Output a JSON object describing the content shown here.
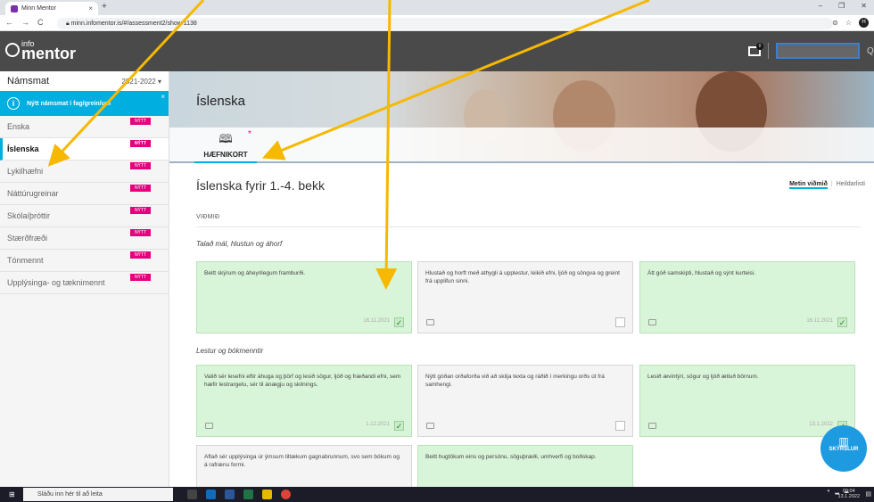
{
  "browser": {
    "tab_title": "Minn Mentor",
    "tab_close": "×",
    "new_tab": "+",
    "url": "minn.infomentor.is/#/assessment2/show/1138",
    "win_min": "–",
    "win_restore": "❐",
    "win_close": "✕",
    "profile_initial": "H"
  },
  "header": {
    "logo_top": "info",
    "logo_main": "mentor",
    "mail_count": "0",
    "user_letter": "Q"
  },
  "sidebar": {
    "title": "Námsmat",
    "year": "2021-2022 ▾",
    "notice": "Nýtt námsmat í fag/grein/um",
    "notice_close": "×",
    "items": [
      {
        "label": "Enska",
        "badge": "NÝTT"
      },
      {
        "label": "Íslenska",
        "badge": "NÝTT"
      },
      {
        "label": "Lykilhæfni",
        "badge": "NÝTT"
      },
      {
        "label": "Náttúrugreinar",
        "badge": "NÝTT"
      },
      {
        "label": "Skólaíþróttir",
        "badge": "NÝTT"
      },
      {
        "label": "Stærðfræði",
        "badge": "NÝTT"
      },
      {
        "label": "Tónmennt",
        "badge": "NÝTT"
      },
      {
        "label": "Upplýsinga- og tæknimennt",
        "badge": "NÝTT"
      }
    ]
  },
  "hero": {
    "title": "Íslenska",
    "tab_label": "HÆFNIKORT",
    "tab_star": "*"
  },
  "main": {
    "course_title": "Íslenska fyrir 1.-4. bekk",
    "view_active": "Metin viðmið",
    "view_other": "Heildarlisti",
    "column_header": "VIÐMIÐ",
    "sections": [
      {
        "title": "Talað mál, hlustun og áhorf",
        "cards": [
          {
            "text": "Beitt skýrum og áheyrilegum framburði.",
            "date": "16.11.2021",
            "met": true
          },
          {
            "text": "Hlustað og horft með athygli á upplestur, leikið efni, ljóð og söngva og greint frá upplifun sinni.",
            "date": "",
            "met": false
          },
          {
            "text": "Átt góð samskipti, hlustað og sýnt kurteisi.",
            "date": "16.11.2021",
            "met": true
          }
        ]
      },
      {
        "title": "Lestur og bókmenntir",
        "cards": [
          {
            "text": "Valið sér lesefni eftir áhuga og þörf og lesið sögur, ljóð og fræðandi efni, sem hæfir lestrargetu, sér til ánægju og skilnings.",
            "date": "1.12.2021",
            "met": true
          },
          {
            "text": "Nýtt góðan orðaforða við að skilja texta og ráðið í merkingu orðs út frá samhengi.",
            "date": "",
            "met": false
          },
          {
            "text": "Lesið ævintýri, sögur og ljóð ætluð börnum.",
            "date": "13.1.2022",
            "met": true
          }
        ]
      },
      {
        "title": "",
        "cards": [
          {
            "text": "Aflað sér upplýsinga úr ýmsum tiltækum gagnabrunnum, svo sem bókum og á rafrænu formi.",
            "date": "",
            "met": false
          },
          {
            "text": "Beitt hugtökum eins og persónu, söguþræði, umhverfi og boðskap.",
            "date": "",
            "met": true
          }
        ]
      }
    ],
    "check_mark": "✓",
    "skyrslur_label": "SKÝRSLUR"
  },
  "taskbar": {
    "search_placeholder": "Sláðu inn hér til að leita",
    "time": "09:04",
    "date": "13.1.2022"
  },
  "colors": {
    "accent": "#00aee0",
    "badge": "#e6007e",
    "met_card": "#d9f5d9",
    "annotation_arrow": "#f6b800"
  }
}
